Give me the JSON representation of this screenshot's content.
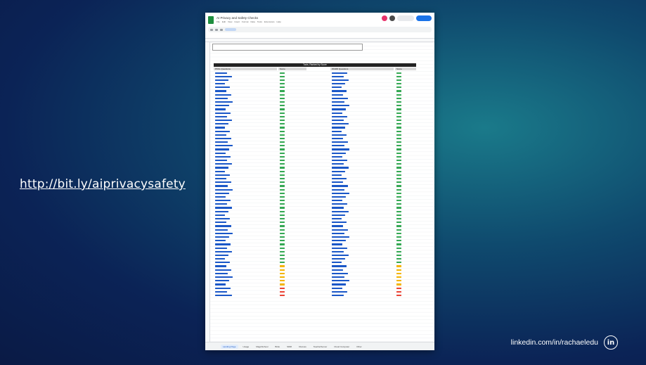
{
  "slide": {
    "link_text": "http://bit.ly/aiprivacysafety",
    "footer_text": "linkedin.com/in/rachaeledu",
    "footer_icon": "in"
  },
  "sheet": {
    "title": "AI Privacy and Safety Checks",
    "menu": [
      "File",
      "Edit",
      "View",
      "Insert",
      "Format",
      "Data",
      "Tools",
      "Extensions",
      "Help"
    ],
    "band_title": "Tools, Ranked by Score",
    "left_header": "PKKL Questions",
    "left_score_header": "Score",
    "right_header": "WARD Questions",
    "right_score_header": "Score",
    "tabs": [
      "Landing Page",
      "Usage",
      "MagicSchool",
      "Brisk",
      "SDRI",
      "Discuss",
      "TeacherServer",
      "Cloud Computer",
      "Other"
    ],
    "active_tab": 0
  },
  "colors": {
    "name_link": "#1a57c8",
    "score_green": "#34a853",
    "score_yellow": "#f4b400",
    "score_red": "#ea4335"
  }
}
